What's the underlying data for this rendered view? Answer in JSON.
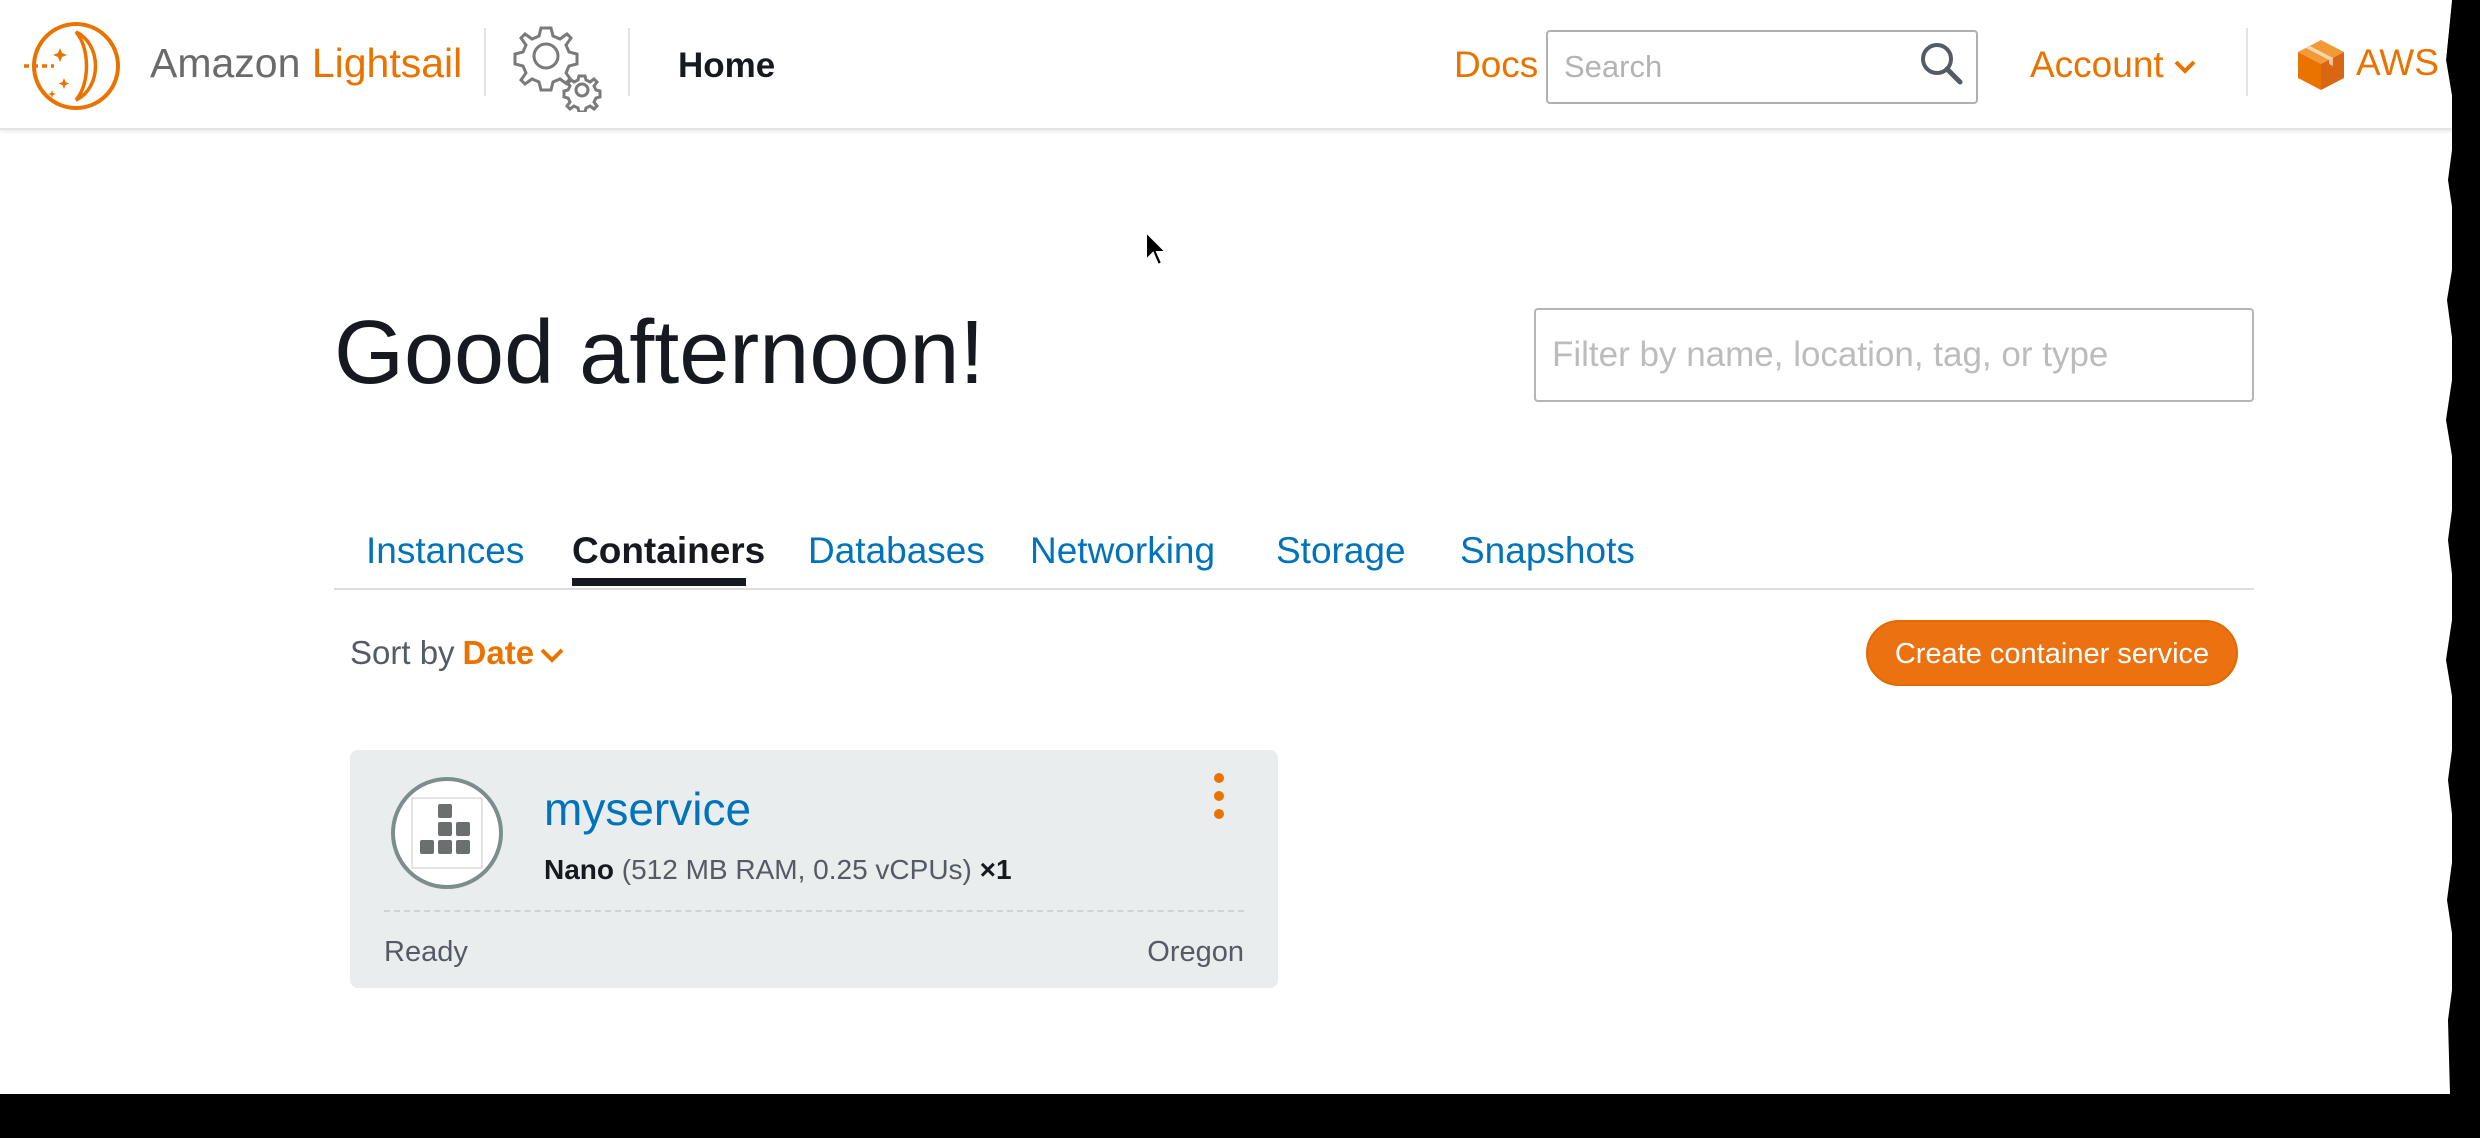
{
  "header": {
    "brand_prefix": "Amazon",
    "brand_name": "Lightsail",
    "page_label": "Home",
    "docs_label": "Docs",
    "search_placeholder": "Search",
    "account_label": "Account",
    "aws_label": "AWS"
  },
  "main": {
    "greeting": "Good afternoon!",
    "filter_placeholder": "Filter by name, location, tag, or type",
    "tabs": [
      {
        "label": "Instances",
        "active": false
      },
      {
        "label": "Containers",
        "active": true
      },
      {
        "label": "Databases",
        "active": false
      },
      {
        "label": "Networking",
        "active": false
      },
      {
        "label": "Storage",
        "active": false
      },
      {
        "label": "Snapshots",
        "active": false
      }
    ],
    "sort": {
      "prefix": "Sort by",
      "value": "Date"
    },
    "create_button": "Create container service",
    "services": [
      {
        "name": "myservice",
        "power": "Nano",
        "specs": "(512 MB RAM, 0.25 vCPUs)",
        "scale": "×1",
        "status": "Ready",
        "region": "Oregon"
      }
    ]
  },
  "colors": {
    "accent": "#ea7300",
    "link": "#0073bb",
    "button": "#ec7211",
    "card_bg": "#eaeded"
  },
  "icons": [
    "lightsail-logo-icon",
    "gears-icon",
    "search-icon",
    "chevron-down-icon",
    "aws-cube-icon",
    "container-icon",
    "more-vertical-icon",
    "cursor-icon"
  ]
}
